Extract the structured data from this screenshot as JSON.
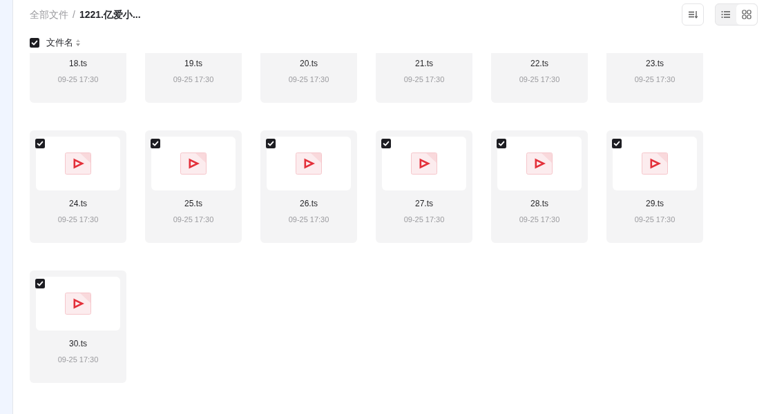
{
  "breadcrumb": {
    "separator": "/",
    "items": [
      {
        "label": "全部文件",
        "current": false
      },
      {
        "label": "1221.亿爱小...",
        "current": true
      }
    ]
  },
  "toolbar": {
    "view_modes": [
      {
        "kind": "list",
        "selected": false
      },
      {
        "kind": "grid",
        "selected": true
      }
    ]
  },
  "list_header": {
    "checked": true,
    "label": "文件名"
  },
  "files": [
    {
      "name": "18.ts",
      "time": "09-25 17:30"
    },
    {
      "name": "19.ts",
      "time": "09-25 17:30"
    },
    {
      "name": "20.ts",
      "time": "09-25 17:30"
    },
    {
      "name": "21.ts",
      "time": "09-25 17:30"
    },
    {
      "name": "22.ts",
      "time": "09-25 17:30"
    },
    {
      "name": "23.ts",
      "time": "09-25 17:30"
    },
    {
      "name": "24.ts",
      "time": "09-25 17:30",
      "selected": true
    },
    {
      "name": "25.ts",
      "time": "09-25 17:30",
      "selected": true
    },
    {
      "name": "26.ts",
      "time": "09-25 17:30",
      "selected": true
    },
    {
      "name": "27.ts",
      "time": "09-25 17:30",
      "selected": true
    },
    {
      "name": "28.ts",
      "time": "09-25 17:30",
      "selected": true
    },
    {
      "name": "29.ts",
      "time": "09-25 17:30",
      "selected": true
    },
    {
      "name": "30.ts",
      "time": "09-25 17:30",
      "selected": true
    }
  ]
}
